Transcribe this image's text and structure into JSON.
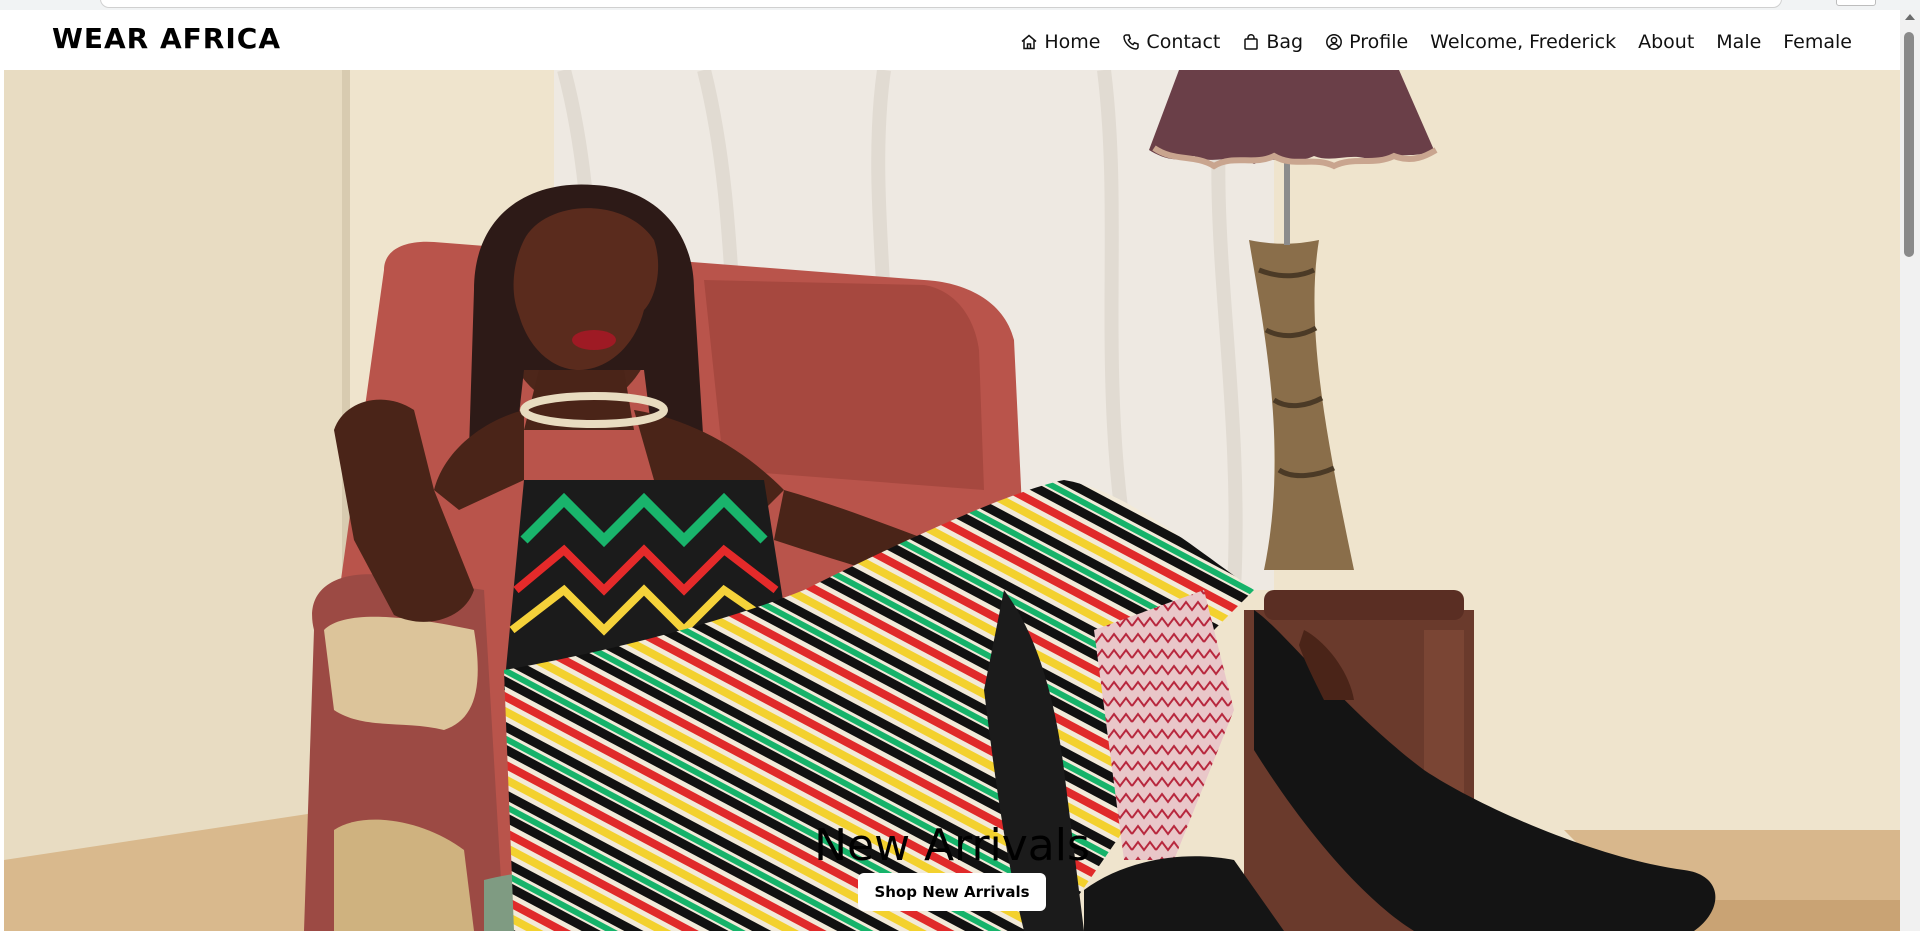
{
  "navbar": {
    "brand": "WEAR AFRICA",
    "links": [
      {
        "label": "Home",
        "icon": "home-icon"
      },
      {
        "label": "Contact",
        "icon": "phone-icon"
      },
      {
        "label": "Bag",
        "icon": "bag-icon"
      },
      {
        "label": "Profile",
        "icon": "profile-icon"
      },
      {
        "label": "Welcome, Frederick"
      },
      {
        "label": "About"
      },
      {
        "label": "Male"
      },
      {
        "label": "Female"
      }
    ]
  },
  "hero": {
    "title": "New Arrivals",
    "button_label": "Shop New Arrivals",
    "image": "woman-in-african-print-dress-on-armchair"
  },
  "colors": {
    "text": "#000000",
    "navbar_bg": "#ffffff",
    "wall": "#efe4cd"
  }
}
